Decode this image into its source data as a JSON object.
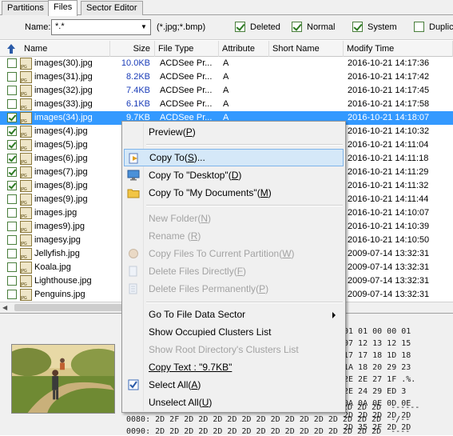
{
  "tabs": [
    {
      "label": "Partitions"
    },
    {
      "label": "Files"
    },
    {
      "label": "Sector Editor"
    }
  ],
  "filter": {
    "name_label": "Name:",
    "name_value": "*.*",
    "ext_hint": "(*.jpg;*.bmp)",
    "checks": [
      {
        "label": "Deleted",
        "checked": true
      },
      {
        "label": "Normal",
        "checked": true
      },
      {
        "label": "System",
        "checked": true
      },
      {
        "label": "Duplica",
        "checked": false
      }
    ]
  },
  "columns": [
    "Name",
    "Size",
    "File Type",
    "Attribute",
    "Short Name",
    "Modify Time"
  ],
  "files": [
    {
      "checked": false,
      "name": "images(30).jpg",
      "size": "10.0KB",
      "type": "ACDSee Pr...",
      "attr": "A",
      "modified": "2016-10-21 14:17:36"
    },
    {
      "checked": false,
      "name": "images(31).jpg",
      "size": "8.2KB",
      "type": "ACDSee Pr...",
      "attr": "A",
      "modified": "2016-10-21 14:17:42"
    },
    {
      "checked": false,
      "name": "images(32).jpg",
      "size": "7.4KB",
      "type": "ACDSee Pr...",
      "attr": "A",
      "modified": "2016-10-21 14:17:45"
    },
    {
      "checked": false,
      "name": "images(33).jpg",
      "size": "6.1KB",
      "type": "ACDSee Pr...",
      "attr": "A",
      "modified": "2016-10-21 14:17:58"
    },
    {
      "checked": true,
      "name": "images(34).jpg",
      "size": "9.7KB",
      "type": "ACDSee Pr...",
      "attr": "A",
      "modified": "2016-10-21 14:18:07",
      "selected": true
    },
    {
      "checked": true,
      "name": "images(4).jpg",
      "size": "",
      "type": "",
      "attr": "",
      "modified": "2016-10-21 14:10:32"
    },
    {
      "checked": true,
      "name": "images(5).jpg",
      "size": "",
      "type": "",
      "attr": "",
      "modified": "2016-10-21 14:11:04"
    },
    {
      "checked": true,
      "name": "images(6).jpg",
      "size": "",
      "type": "",
      "attr": "",
      "modified": "2016-10-21 14:11:18"
    },
    {
      "checked": true,
      "name": "images(7).jpg",
      "size": "",
      "type": "",
      "attr": "",
      "modified": "2016-10-21 14:11:29"
    },
    {
      "checked": true,
      "name": "images(8).jpg",
      "size": "",
      "type": "",
      "attr": "",
      "modified": "2016-10-21 14:11:32"
    },
    {
      "checked": false,
      "name": "images(9).jpg",
      "size": "",
      "type": "",
      "attr": "",
      "modified": "2016-10-21 14:11:44"
    },
    {
      "checked": false,
      "name": "images.jpg",
      "size": "",
      "type": "",
      "attr": "",
      "modified": "2016-10-21 14:10:07"
    },
    {
      "checked": false,
      "name": "images9).jpg",
      "size": "",
      "type": "",
      "attr": "",
      "modified": "2016-10-21 14:10:39"
    },
    {
      "checked": false,
      "name": "imagesy.jpg",
      "size": "",
      "type": "",
      "attr": "",
      "modified": "2016-10-21 14:10:50"
    },
    {
      "checked": false,
      "name": "Jellyfish.jpg",
      "size": "",
      "type": "",
      "attr": "",
      "modified": "2009-07-14 13:32:31"
    },
    {
      "checked": false,
      "name": "Koala.jpg",
      "size": "",
      "type": "",
      "attr": "",
      "modified": "2009-07-14 13:32:31"
    },
    {
      "checked": false,
      "name": "Lighthouse.jpg",
      "size": "",
      "type": "",
      "attr": "",
      "modified": "2009-07-14 13:32:31"
    },
    {
      "checked": false,
      "name": "Penguins.jpg",
      "size": "",
      "type": "",
      "attr": "",
      "modified": "2009-07-14 13:32:31"
    }
  ],
  "hex": {
    "partial": [
      "01 01 00 00 01",
      "07 12 13 12 15",
      "17 17 18 1D 18",
      "1A 18 20 29 23",
      "2E 2E 27 1F .%.",
      "2E 24 29 ED 3",
      "0A 0A 0E 0D 0E",
      "2D 2D 2D 2D 2D",
      "2D 35 2F 2D 2D"
    ],
    "full": [
      "0070: 2D 2D 2D 2D 2D 2D 2D 2D 2D 2D 2D 2D 2D 2D 2D 2D  ------",
      "0080: 2D 2F 2D 2D 2D 2D 2D 2D 2D 2D 2D 2D 2D 2D 2D 2D  -/--",
      "0090: 2D 2D 2D 2D 2D 2D 2D 2D 2D 2D 2D 2D 2D 2D 2D 2D  ----"
    ]
  },
  "context_menu": {
    "preview": {
      "text": "Preview",
      "key": "P"
    },
    "copy_to": {
      "text": "Copy To",
      "key": "S",
      "suffix": "..."
    },
    "copy_desktop": {
      "text": "Copy To \"Desktop\"",
      "key": "D"
    },
    "copy_docs": {
      "text": "Copy To \"My Documents\"",
      "key": "M"
    },
    "new_folder": {
      "text": "New Folder",
      "key": "N"
    },
    "rename": {
      "text": "Rename ",
      "key": "R"
    },
    "copy_partition": {
      "text": "Copy Files To Current Partition",
      "key": "W"
    },
    "delete_directly": {
      "text": "Delete Files Directly",
      "key": "F"
    },
    "delete_permanently": {
      "text": "Delete Files Permanently",
      "key": "P"
    },
    "go_sector": {
      "text": "Go To File Data Sector"
    },
    "show_clusters": {
      "text": "Show Occupied Clusters List"
    },
    "show_root": {
      "text": "Show Root Directory's Clusters List"
    },
    "copy_text": {
      "text": "Copy Text : \"9.7KB\""
    },
    "select_all": {
      "text": "Select All",
      "key": "A"
    },
    "unselect_all": {
      "text": "Unselect All",
      "key": "U"
    }
  }
}
